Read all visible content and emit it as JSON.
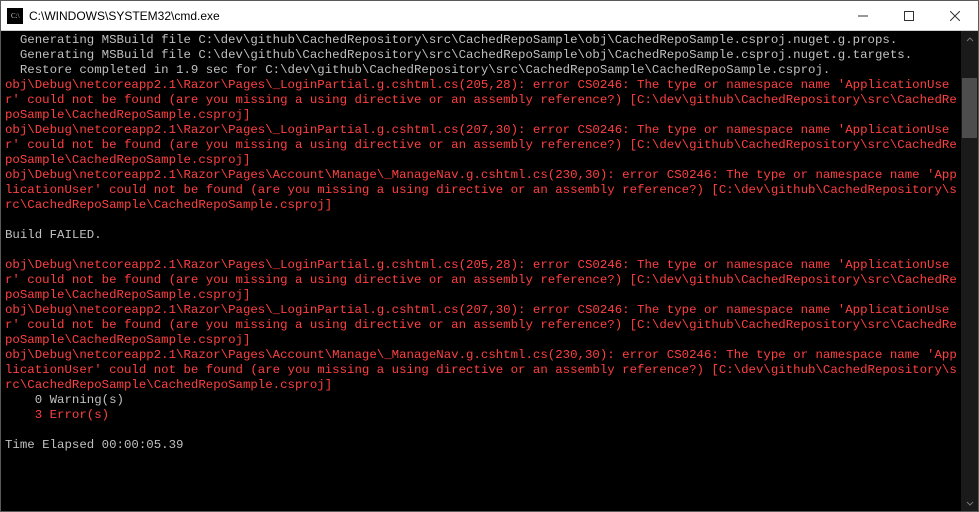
{
  "window": {
    "title": "C:\\WINDOWS\\SYSTEM32\\cmd.exe"
  },
  "terminal": {
    "lines": [
      {
        "cls": "gray",
        "indent": true,
        "text": "Generating MSBuild file C:\\dev\\github\\CachedRepository\\src\\CachedRepoSample\\obj\\CachedRepoSample.csproj.nuget.g.props."
      },
      {
        "cls": "gray",
        "indent": false,
        "text": "  Generating MSBuild file C:\\dev\\github\\CachedRepository\\src\\CachedRepoSample\\obj\\CachedRepoSample.csproj.nuget.g.targets."
      },
      {
        "cls": "gray",
        "indent": true,
        "text": "Restore completed in 1.9 sec for C:\\dev\\github\\CachedRepository\\src\\CachedRepoSample\\CachedRepoSample.csproj."
      },
      {
        "cls": "red",
        "indent": false,
        "text": "obj\\Debug\\netcoreapp2.1\\Razor\\Pages\\_LoginPartial.g.cshtml.cs(205,28): error CS0246: The type or namespace name 'ApplicationUser' could not be found (are you missing a using directive or an assembly reference?) [C:\\dev\\github\\CachedRepository\\src\\CachedRepoSample\\CachedRepoSample.csproj]"
      },
      {
        "cls": "red",
        "indent": false,
        "text": "obj\\Debug\\netcoreapp2.1\\Razor\\Pages\\_LoginPartial.g.cshtml.cs(207,30): error CS0246: The type or namespace name 'ApplicationUser' could not be found (are you missing a using directive or an assembly reference?) [C:\\dev\\github\\CachedRepository\\src\\CachedRepoSample\\CachedRepoSample.csproj]"
      },
      {
        "cls": "red",
        "indent": false,
        "text": "obj\\Debug\\netcoreapp2.1\\Razor\\Pages\\Account\\Manage\\_ManageNav.g.cshtml.cs(230,30): error CS0246: The type or namespace name 'ApplicationUser' could not be found (are you missing a using directive or an assembly reference?) [C:\\dev\\github\\CachedRepository\\src\\CachedRepoSample\\CachedRepoSample.csproj]"
      },
      {
        "cls": "gray",
        "indent": false,
        "text": ""
      },
      {
        "cls": "gray",
        "indent": false,
        "text": "Build FAILED."
      },
      {
        "cls": "gray",
        "indent": false,
        "text": ""
      },
      {
        "cls": "red",
        "indent": false,
        "text": "obj\\Debug\\netcoreapp2.1\\Razor\\Pages\\_LoginPartial.g.cshtml.cs(205,28): error CS0246: The type or namespace name 'ApplicationUser' could not be found (are you missing a using directive or an assembly reference?) [C:\\dev\\github\\CachedRepository\\src\\CachedRepoSample\\CachedRepoSample.csproj]"
      },
      {
        "cls": "red",
        "indent": false,
        "text": "obj\\Debug\\netcoreapp2.1\\Razor\\Pages\\_LoginPartial.g.cshtml.cs(207,30): error CS0246: The type or namespace name 'ApplicationUser' could not be found (are you missing a using directive or an assembly reference?) [C:\\dev\\github\\CachedRepository\\src\\CachedRepoSample\\CachedRepoSample.csproj]"
      },
      {
        "cls": "red",
        "indent": false,
        "text": "obj\\Debug\\netcoreapp2.1\\Razor\\Pages\\Account\\Manage\\_ManageNav.g.cshtml.cs(230,30): error CS0246: The type or namespace name 'ApplicationUser' could not be found (are you missing a using directive or an assembly reference?) [C:\\dev\\github\\CachedRepository\\src\\CachedRepoSample\\CachedRepoSample.csproj]"
      },
      {
        "cls": "gray",
        "indent": false,
        "text": "    0 Warning(s)"
      },
      {
        "cls": "red",
        "indent": false,
        "text": "    3 Error(s)"
      },
      {
        "cls": "gray",
        "indent": false,
        "text": ""
      },
      {
        "cls": "gray",
        "indent": false,
        "text": "Time Elapsed 00:00:05.39"
      }
    ]
  }
}
